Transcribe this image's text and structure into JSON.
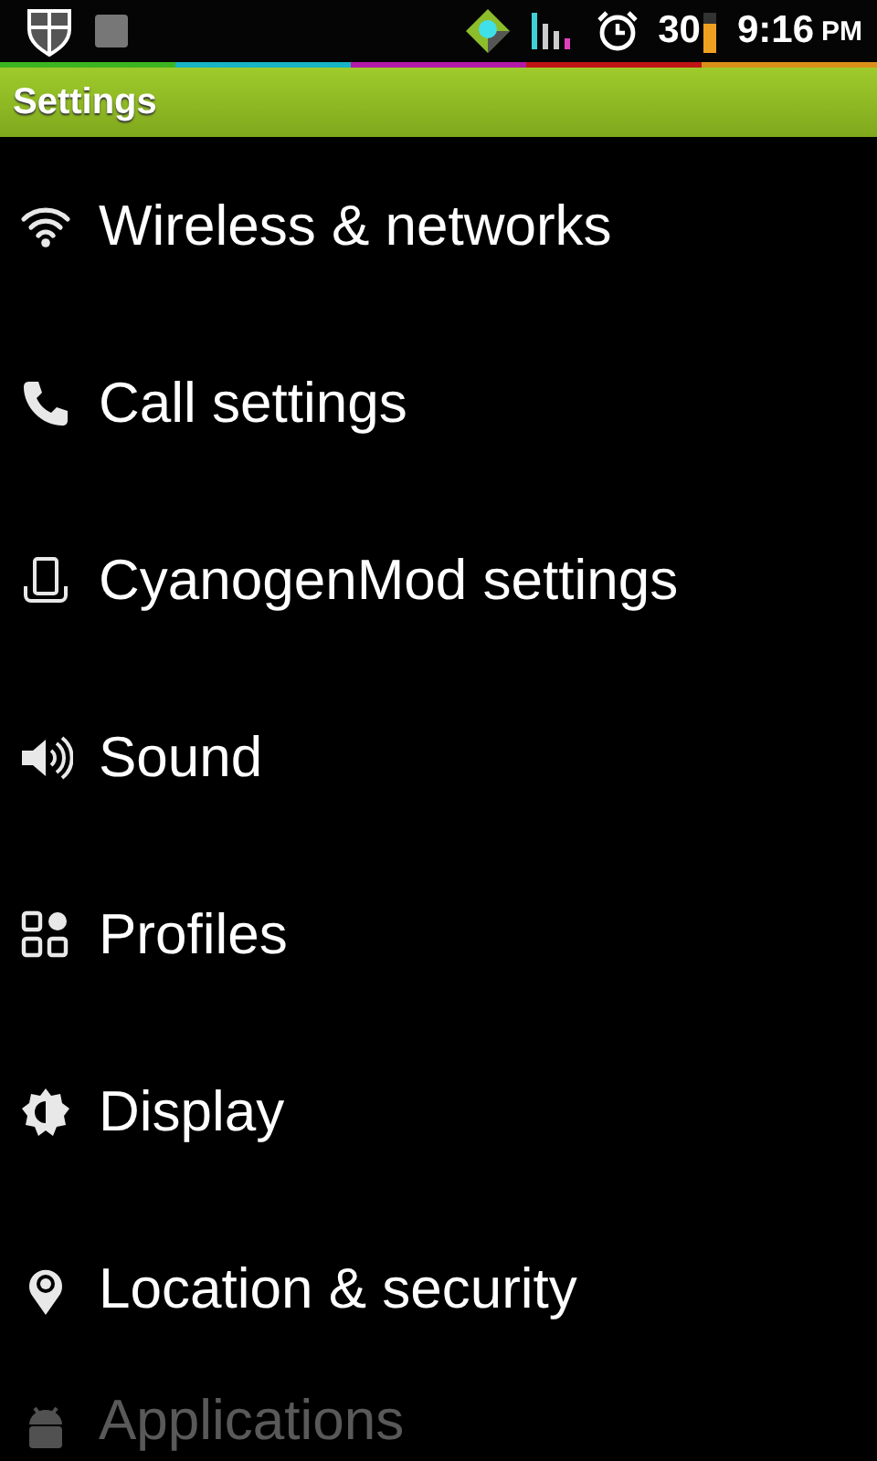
{
  "status_bar": {
    "battery_percent": "30",
    "time": "9:16",
    "meridiem": "PM"
  },
  "title_bar": {
    "title": "Settings"
  },
  "items": [
    {
      "label": "Wireless & networks"
    },
    {
      "label": "Call settings"
    },
    {
      "label": "CyanogenMod settings"
    },
    {
      "label": "Sound"
    },
    {
      "label": "Profiles"
    },
    {
      "label": "Display"
    },
    {
      "label": "Location & security"
    },
    {
      "label": "Applications"
    }
  ]
}
